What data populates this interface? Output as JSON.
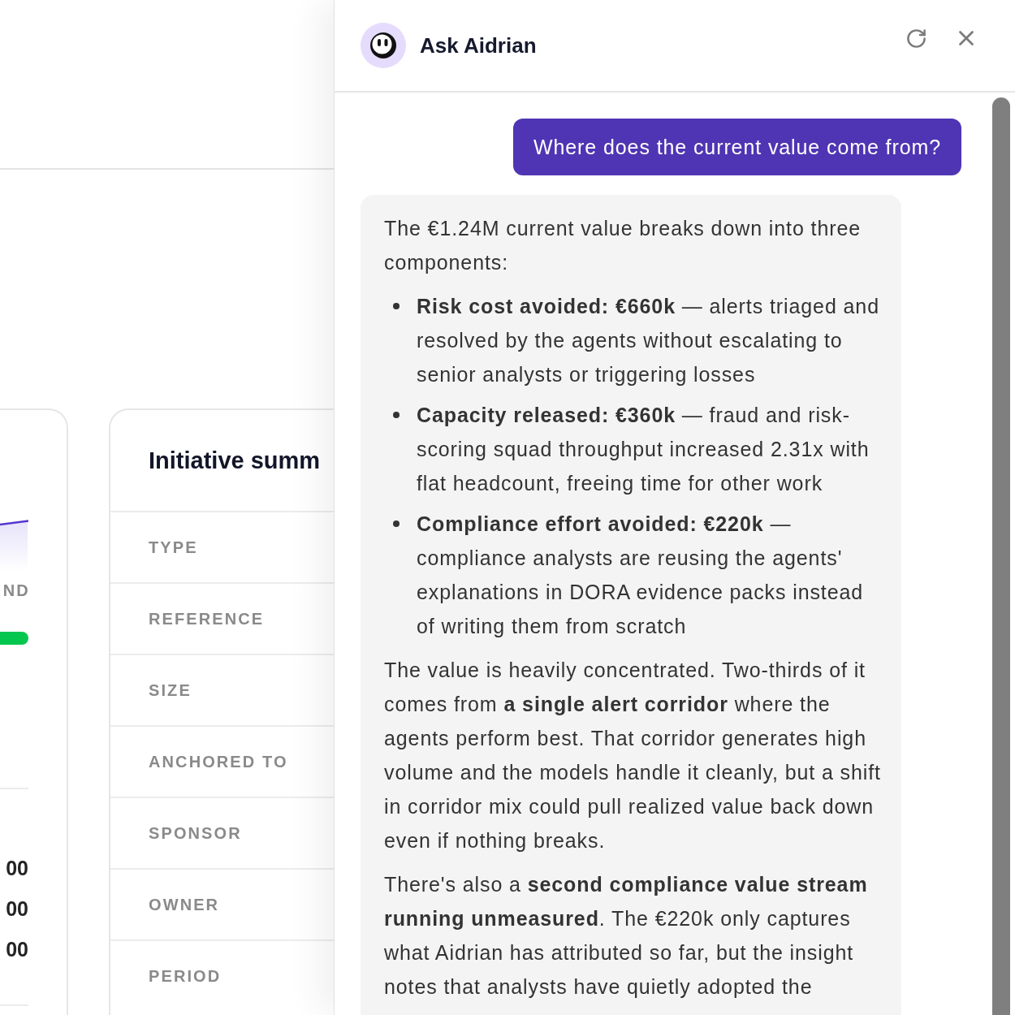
{
  "background": {
    "metrics_card": {
      "label": "ND",
      "values": [
        "00",
        "00",
        "00"
      ]
    },
    "summary_card": {
      "title": "Initiative summ",
      "field_labels": [
        "TYPE",
        "REFERENCE",
        "SIZE",
        "ANCHORED TO",
        "SPONSOR",
        "OWNER",
        "PERIOD"
      ]
    }
  },
  "chat_panel": {
    "title": "Ask Aidrian",
    "messages": [
      {
        "kind": "user",
        "text": "Where does the current value come from?"
      },
      {
        "kind": "assistant",
        "blocks": [
          {
            "kind": "paragraph",
            "text": "The €1.24M current value breaks down into three components:"
          },
          {
            "kind": "bullets",
            "items": [
              "**Risk cost avoided: €660k** — alerts triaged and resolved by the agents without escalating to senior analysts or triggering losses",
              "**Capacity released: €360k** — fraud and risk-scoring squad throughput increased 2.31x with flat headcount, freeing time for other work",
              "**Compliance effort avoided: €220k** — compliance analysts are reusing the agents' explanations in DORA evidence packs instead of writing them from scratch"
            ]
          },
          {
            "kind": "paragraph",
            "text": "The value is heavily concentrated. Two-thirds of it comes from **a single alert corridor** where the agents perform best. That corridor generates high volume and the models handle it cleanly, but a shift in corridor mix could pull realized value back down even if nothing breaks."
          },
          {
            "kind": "paragraph",
            "text": "There's also a **second compliance value stream running unmeasured**. The €220k only captures what Aidrian has attributed so far, but the insight notes that analysts have quietly adopted the"
          }
        ]
      }
    ]
  }
}
